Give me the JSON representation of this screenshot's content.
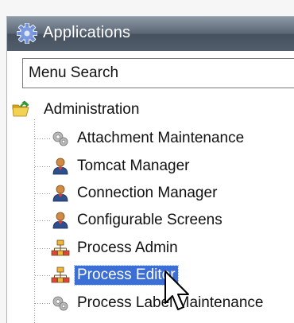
{
  "window": {
    "title": "Applications",
    "title_icon": "gear-icon"
  },
  "search": {
    "value": "Menu Search",
    "placeholder": "Menu Search"
  },
  "tree": {
    "root": {
      "label": "Administration",
      "icon": "folder-open-icon"
    },
    "items": [
      {
        "label": "Attachment Maintenance",
        "icon": "gears-icon",
        "selected": false
      },
      {
        "label": "Tomcat Manager",
        "icon": "user-icon",
        "selected": false
      },
      {
        "label": "Connection Manager",
        "icon": "user-icon",
        "selected": false
      },
      {
        "label": "Configurable Screens",
        "icon": "user-icon",
        "selected": false
      },
      {
        "label": "Process Admin",
        "icon": "process-icon",
        "selected": false
      },
      {
        "label": "Process Editor",
        "icon": "process-icon",
        "selected": true
      },
      {
        "label": "Process Label Maintenance",
        "icon": "gears-icon",
        "selected": false
      }
    ]
  },
  "colors": {
    "titlebar": "#525e6c",
    "selection": "#3b6fd6",
    "background": "#ffffff"
  }
}
